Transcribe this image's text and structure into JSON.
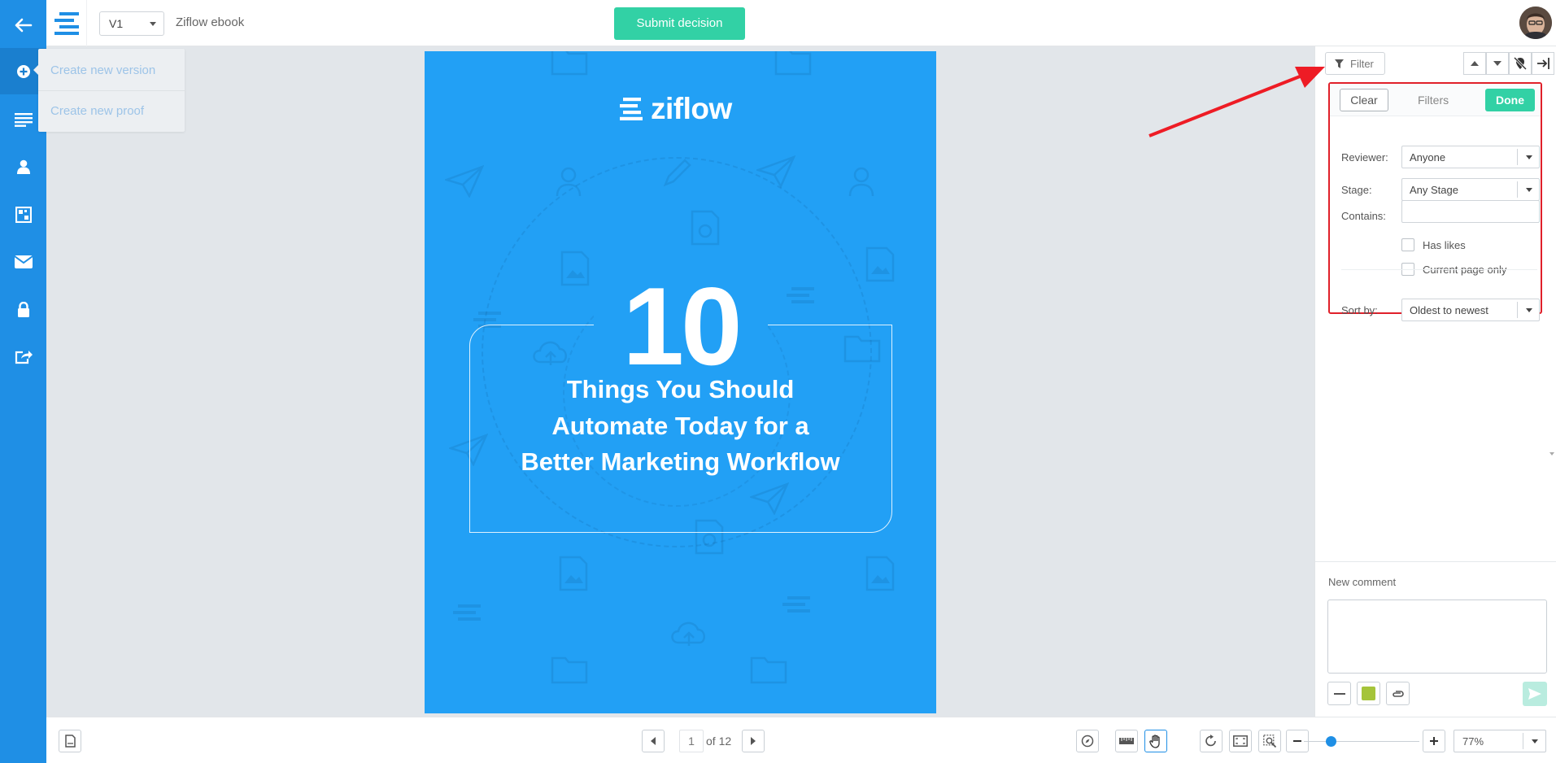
{
  "topbar": {
    "version": "V1",
    "document_title": "Ziflow ebook",
    "submit_label": "Submit decision"
  },
  "leftnav": {
    "items": [
      {
        "icon": "back-arrow-icon"
      },
      {
        "icon": "plus-circle-icon"
      },
      {
        "icon": "list-lines-icon"
      },
      {
        "icon": "user-icon"
      },
      {
        "icon": "compare-icon"
      },
      {
        "icon": "envelope-icon"
      },
      {
        "icon": "lock-icon"
      },
      {
        "icon": "share-icon"
      }
    ]
  },
  "create_menu": {
    "items": [
      "Create new version",
      "Create new proof"
    ]
  },
  "document": {
    "brand": "ziflow",
    "number": "10",
    "lines": [
      "Things You Should",
      "Automate Today for a",
      "Better Marketing Workflow"
    ],
    "background_color": "#22a0f5"
  },
  "comments_panel": {
    "filter_label": "Filter",
    "filter_panel": {
      "clear_label": "Clear",
      "title": "Filters",
      "done_label": "Done",
      "reviewer_label": "Reviewer:",
      "reviewer_value": "Anyone",
      "stage_label": "Stage:",
      "stage_value": "Any Stage",
      "contains_label": "Contains:",
      "contains_value": "",
      "has_likes_label": "Has likes",
      "current_page_label": "Current page only",
      "sort_label": "Sort by:",
      "sort_value": "Oldest to newest"
    },
    "new_comment_label": "New comment",
    "colors": {
      "accent": "#32d1a5",
      "highlight": "#e0202a",
      "swatch": "#a5c43a"
    }
  },
  "bottombar": {
    "current_page": "1",
    "page_total": "of 12",
    "zoom": "77%",
    "zoom_level": 0.23
  }
}
